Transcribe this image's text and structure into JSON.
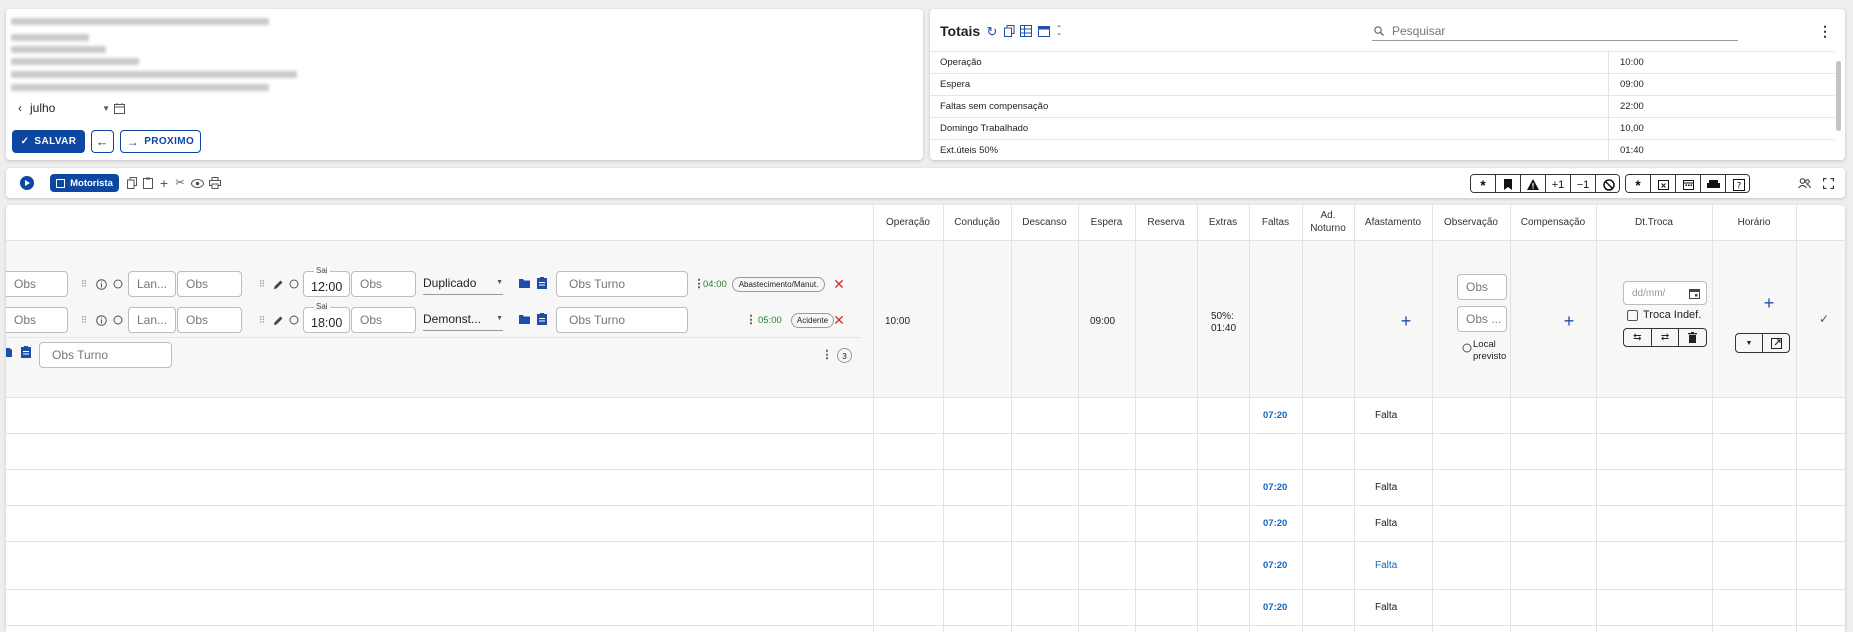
{
  "header": {
    "month_value": "julho",
    "save_label": "SALVAR",
    "next_label": "PROXIMO"
  },
  "totals": {
    "title": "Totais",
    "search_placeholder": "Pesquisar",
    "rows": [
      {
        "label": "Operação",
        "value": "10:00"
      },
      {
        "label": "Espera",
        "value": "09:00"
      },
      {
        "label": "Faltas sem compensação",
        "value": "22:00"
      },
      {
        "label": "Domingo Trabalhado",
        "value": "10,00"
      },
      {
        "label": "Ext.úteis 50%",
        "value": "01:40"
      }
    ]
  },
  "toolbar": {
    "driver_toggle_label": "Motorista",
    "right_buttons": [
      "+1",
      "−1"
    ]
  },
  "table": {
    "columns": [
      "Operação",
      "Condução",
      "Descanso",
      "Espera",
      "Reserva",
      "Extras",
      "Faltas",
      "Ad. Noturno",
      "Afastamento",
      "Observação",
      "Compensação",
      "Dt.Troca",
      "Horário"
    ],
    "detail": {
      "line1": {
        "obs1": "Obs",
        "lan": "Lan...",
        "obs2": "Obs",
        "time_label": "Sai",
        "time": "12:00",
        "obs3": "Obs",
        "select_value": "Duplicado",
        "obs_turno_placeholder": "Obs Turno",
        "duration": "04:00",
        "tag": "Abastecimento/Manut."
      },
      "line2": {
        "obs1": "Obs",
        "lan": "Lan...",
        "obs2": "Obs",
        "time_label": "Sai",
        "time": "18:00",
        "obs3": "Obs",
        "select_value": "Demonst...",
        "obs_turno_placeholder": "Obs Turno",
        "duration": "05:00",
        "tag": "Acidente"
      },
      "line3": {
        "obs_turno_placeholder": "Obs Turno",
        "count": "3"
      },
      "operacao": "10:00",
      "espera": "09:00",
      "extras_label": "50%:",
      "extras_value": "01:40",
      "obs_field_1": "Obs",
      "obs_field_2": "Obs ...",
      "local_previsto": "Local previsto",
      "date_placeholder": "dd/mm/",
      "troca_indef": "Troca Indef."
    },
    "rows": [
      {
        "faltas": "07:20",
        "afastamento": "Falta"
      },
      {
        "faltas": "",
        "afastamento": ""
      },
      {
        "faltas": "07:20",
        "afastamento": "Falta"
      },
      {
        "faltas": "07:20",
        "afastamento": "Falta"
      },
      {
        "faltas": "07:20",
        "afastamento": "Falta"
      },
      {
        "faltas": "07:20",
        "afastamento": "Falta"
      }
    ]
  },
  "colors": {
    "primary": "#0d47a1",
    "green": "#2e7d32",
    "red": "#d32f2f",
    "link": "#1565c0"
  }
}
